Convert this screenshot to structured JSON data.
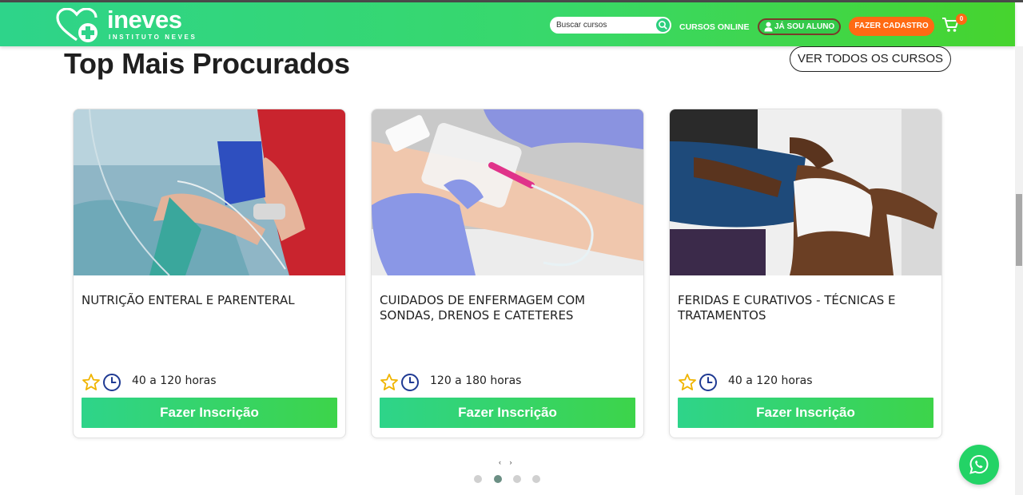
{
  "header": {
    "brand": "ineves",
    "tagline": "INSTITUTO NEVES",
    "search_placeholder": "Buscar cursos",
    "nav_online": "CURSOS ONLINE",
    "btn_aluno": "JÁ SOU ALUNO",
    "btn_cadastro": "FAZER CADASTRO",
    "cart_count": "0",
    "icons": [
      "heart-cross-logo-icon",
      "search-icon",
      "user-icon",
      "cart-icon"
    ]
  },
  "section": {
    "title": "Top Mais Procurados",
    "view_all": "VER TODOS OS CURSOS"
  },
  "courses": [
    {
      "title": "NUTRIÇÃO ENTERAL E PARENTERAL",
      "hours": "40 a 120 horas",
      "cta": "Fazer Inscrição",
      "image": "iv-drip-patient"
    },
    {
      "title": "CUIDADOS DE ENFERMAGEM COM SONDAS, DRENOS E CATETERES",
      "hours": "120 a 180 horas",
      "cta": "Fazer Inscrição",
      "image": "catheter-arm-gloves"
    },
    {
      "title": "FERIDAS E CURATIVOS - TÉCNICAS E TRATAMENTOS",
      "hours": "40 a 120 horas",
      "cta": "Fazer Inscrição",
      "image": "knee-bandage"
    }
  ],
  "carousel": {
    "prev": "‹",
    "next": "›",
    "dots": 4,
    "active_dot": 2
  },
  "colors": {
    "brand_green": "#2ed48a",
    "accent_orange": "#ff6a13",
    "star": "#f0b400",
    "clock": "#1f3a93",
    "whatsapp": "#23d366"
  }
}
